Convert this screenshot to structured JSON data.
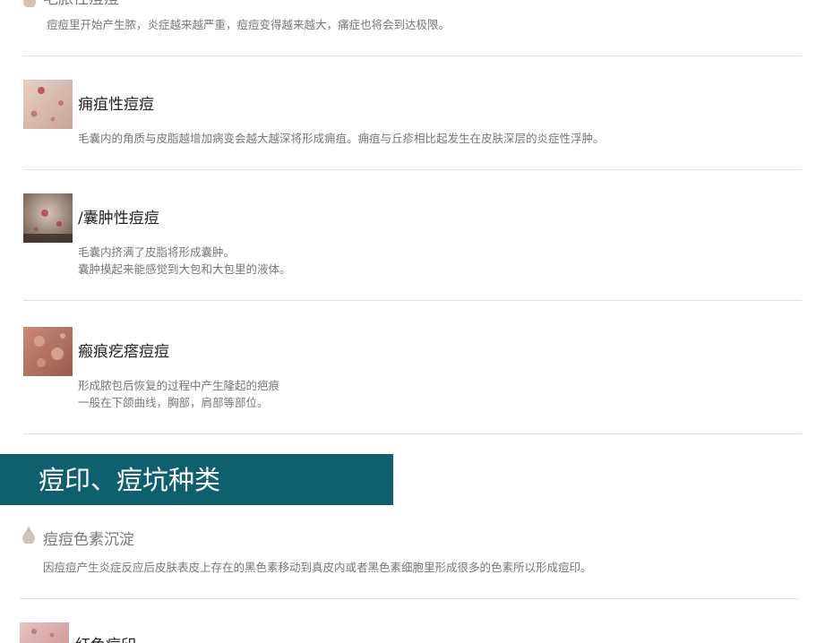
{
  "sections": {
    "top_item": {
      "title": "毛脓性痘痘",
      "desc": "痘痘里开始产生脓，炎症越来越严重，痘痘变得越来越大，痛症也将会到达极限。"
    },
    "items": [
      {
        "title": "痈疽性痘痘",
        "desc_lines": [
          "毛囊内的角质与皮脂越增加病变会越大越深将形成痈疽。痈疽与丘疹相比起发生在皮肤深层的炎症性浮肿。"
        ]
      },
      {
        "title": "/囊肿性痘痘",
        "desc_lines": [
          "毛囊内挤满了皮脂将形成囊肿。",
          "囊肿摸起来能感觉到大包和大包里的液体。"
        ]
      },
      {
        "title": "瘢痕疙瘩痘痘",
        "desc_lines": [
          "形成脓包后恢复的过程中产生隆起的疤痕",
          "一般在下颌曲线，胸部，肩部等部位。"
        ]
      }
    ],
    "banner": {
      "title": "痘印、痘坑种类"
    },
    "pigment": {
      "title": "痘痘色素沉淀",
      "desc": "因痘痘产生炎症反应后皮肤表皮上存在的黑色素移动到真皮内或者黑色素细胞里形成很多的色素所以形成痘印。"
    },
    "bottom_item": {
      "title": "红色痘印"
    }
  },
  "colors": {
    "banner_bg": "#0f5f6e",
    "drop": "#cfc3b5"
  }
}
